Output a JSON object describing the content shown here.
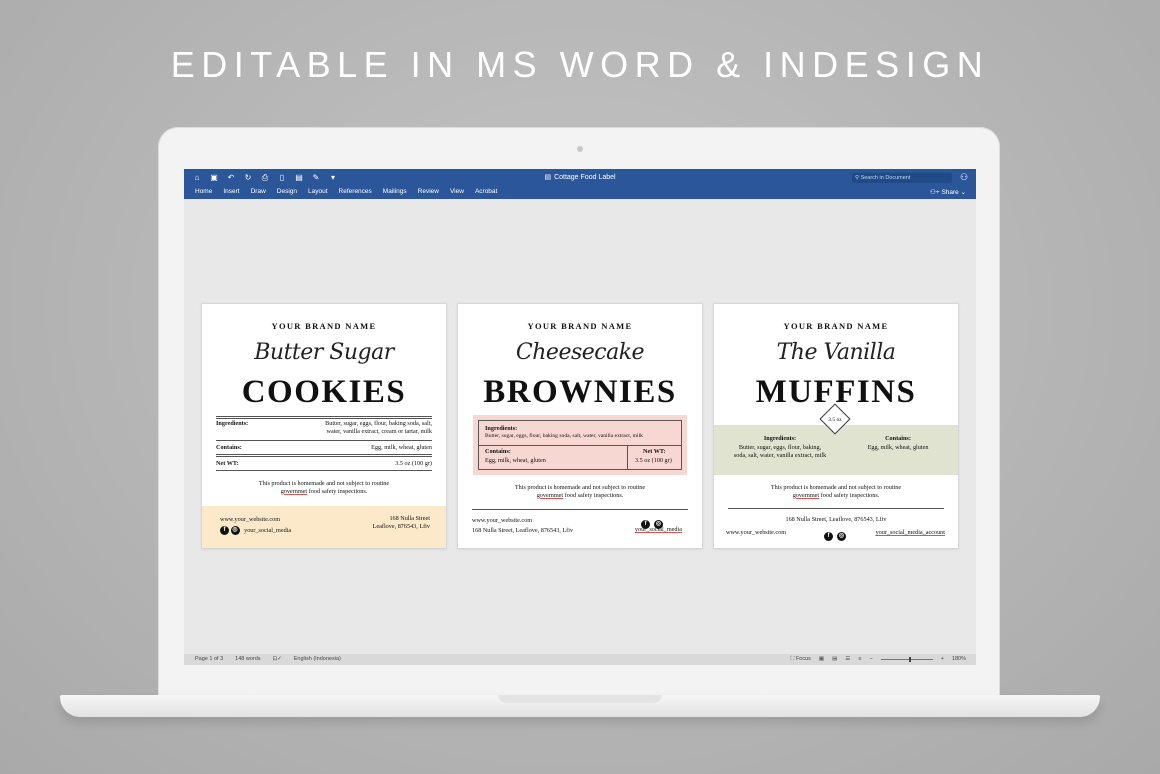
{
  "headline": "EDITABLE IN MS WORD & INDESIGN",
  "word": {
    "doc_title": "Cottage Food Label",
    "search_placeholder": "Search in Document",
    "share_label": "Share",
    "tabs": [
      "Home",
      "Insert",
      "Draw",
      "Design",
      "Layout",
      "References",
      "Mailings",
      "Review",
      "View",
      "Acrobat"
    ],
    "status": {
      "page": "Page 1 of 3",
      "words": "148 words",
      "language": "English (Indonesia)",
      "focus": "Focus",
      "zoom": "180%"
    }
  },
  "labels": [
    {
      "brand": "YOUR BRAND NAME",
      "script": "Butter Sugar",
      "product": "COOKIES",
      "ingredients_label": "Ingredients:",
      "ingredients_line1": "Butter, sugar, eggs, flour, baking soda, salt,",
      "ingredients_line2": "water, vanilla extract, cream or tartar, milk",
      "contains_label": "Contains:",
      "contains": "Egg, milk, wheat, gluten",
      "netwt_label": "Net WT:",
      "netwt": "3.5 oz (100 gr)",
      "notice_line1": "This product is homemade and not subject to routine",
      "notice_line2a": "governmet",
      "notice_line2b": " food safety inspections.",
      "website": "www.your_website.com",
      "social": "your_social_media",
      "address_line1": "168 Nulla Street",
      "address_line2": "Leaflove, 876543, Lfiv"
    },
    {
      "brand": "YOUR BRAND NAME",
      "script": "Cheesecake",
      "product": "BROWNIES",
      "ingredients_label": "Ingredients:",
      "ingredients": "Butter, sugar, eggs, flour, baking soda, salt, water, vanilla extract, milk",
      "contains_label": "Contains:",
      "contains": "Egg, milk, wheat, gluten",
      "netwt_label": "Net WT:",
      "netwt": "3.5 oz (100 gr)",
      "notice_line1": "This product is homemade and not subject to routine",
      "notice_line2a": "governmet",
      "notice_line2b": " food safety inspections.",
      "website": "www.your_website.com",
      "address": "168 Nulla Street, Leaflove, 876543, Lfiv",
      "social": "your_social_media"
    },
    {
      "brand": "YOUR BRAND NAME",
      "script": "The Vanilla",
      "product": "MUFFINS",
      "badge": "3.5 oz",
      "ingredients_label": "Ingredients:",
      "ingredients_line1": "Butter, sugar, eggs, flour, baking,",
      "ingredients_line2": "soda, salt, water, vanilla extract, milk",
      "contains_label": "Contains:",
      "contains": "Egg, milk, wheat, gluten",
      "notice_line1": "This product is homemade and not subject to routine",
      "notice_line2a": "governmet",
      "notice_line2b": " food safety inspections.",
      "address": "168 Nulla Street, Leaflove, 876543, Lfiv",
      "website": "www.your_website.com",
      "social": "your_social_media_account"
    }
  ],
  "icons": {
    "facebook": "f",
    "instagram": "◎"
  }
}
